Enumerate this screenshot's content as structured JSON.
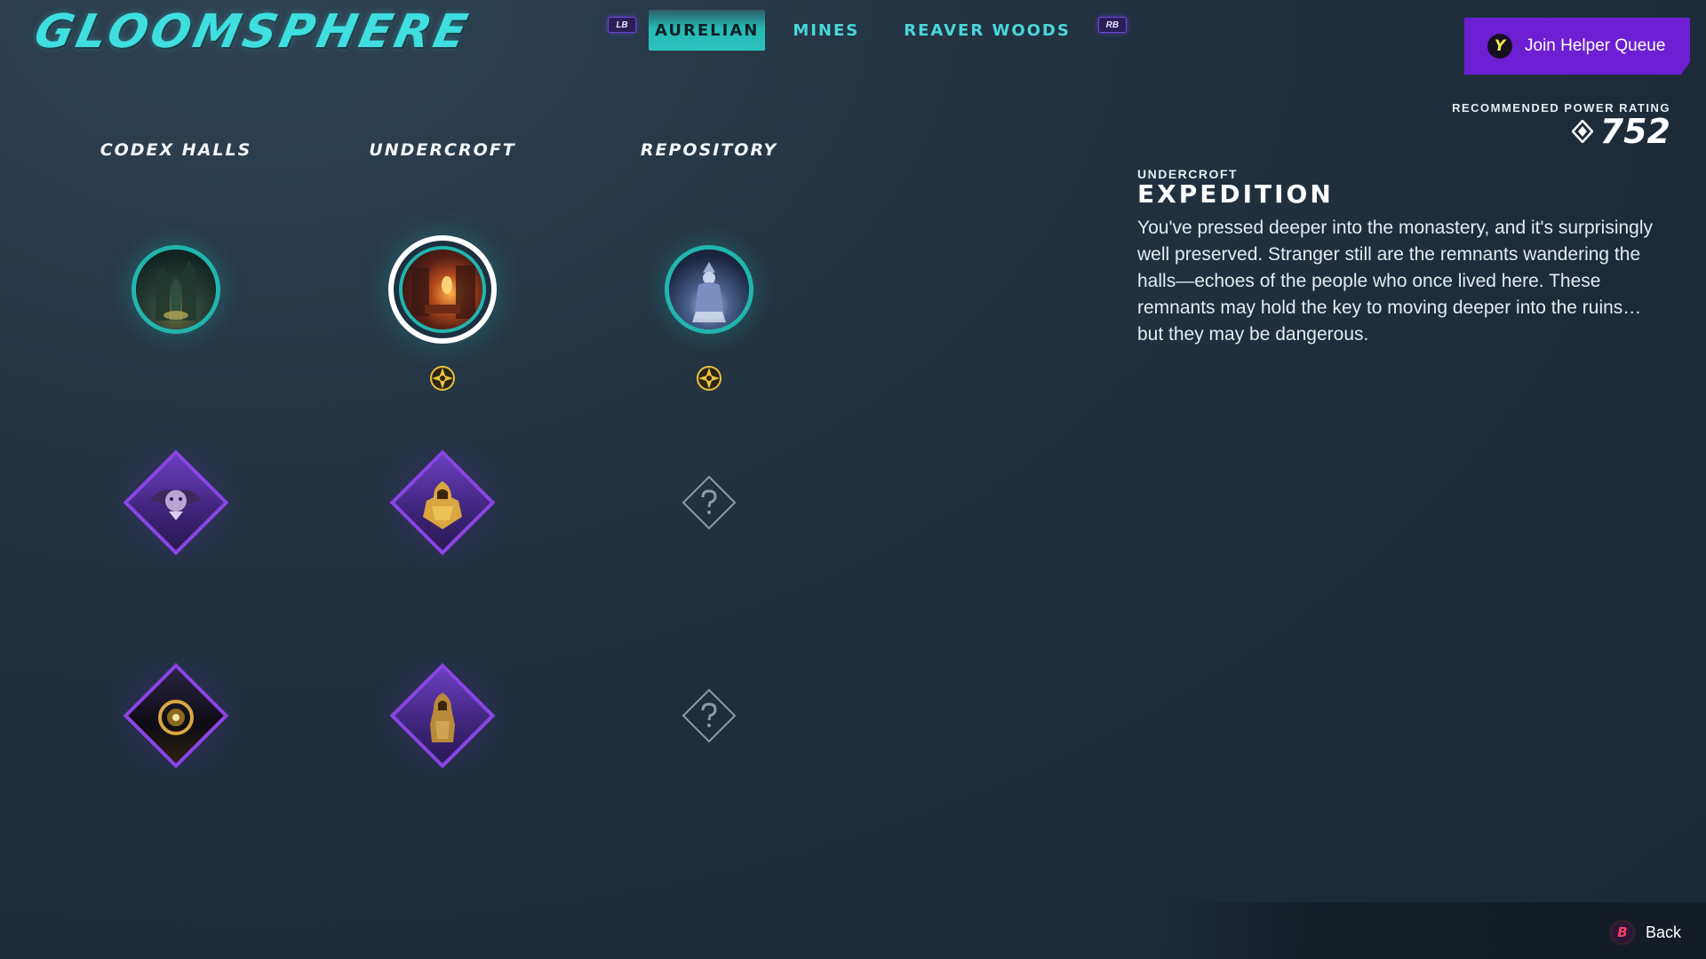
{
  "game": {
    "title": "GLOOMSPHERE"
  },
  "tabs": {
    "left_bumper": "LB",
    "right_bumper": "RB",
    "items": [
      {
        "label": "AURELIAN",
        "active": true
      },
      {
        "label": "MINES",
        "active": false
      },
      {
        "label": "REAVER WOODS",
        "active": false
      }
    ]
  },
  "helper": {
    "key": "Y",
    "label": "Join Helper Queue"
  },
  "columns": [
    {
      "title": "CODEX HALLS"
    },
    {
      "title": "UNDERCROFT"
    },
    {
      "title": "REPOSITORY"
    }
  ],
  "recommended": {
    "label": "RECOMMENDED POWER RATING",
    "value": "752"
  },
  "detail": {
    "subtitle": "UNDERCROFT",
    "title": "EXPEDITION",
    "body": "You've pressed deeper into the monastery, and it's surprisingly well preserved. Stranger still are the remnants wandering the halls—echoes of the people who once lived here. These remnants may hold the key to moving deeper into the ruins… but they may be dangerous."
  },
  "footer": {
    "back_key": "B",
    "back_label": "Back"
  },
  "colors": {
    "accent_teal": "#2bc2bd",
    "accent_purple": "#6d1fd4",
    "gold": "#e8c23a"
  },
  "icons": {
    "expedition_nodes": [
      "forest-cathedral-scene",
      "firelit-chamber-scene",
      "robed-statue-scene"
    ],
    "reward_badges": [
      "gold-compass-icon",
      "gold-compass-icon"
    ],
    "boss_nodes": [
      "winged-creature-icon",
      "golden-armor-icon",
      "golden-eye-orb-icon",
      "robed-figure-icon"
    ],
    "locked_nodes": [
      "question-mark-icon",
      "question-mark-icon"
    ]
  }
}
